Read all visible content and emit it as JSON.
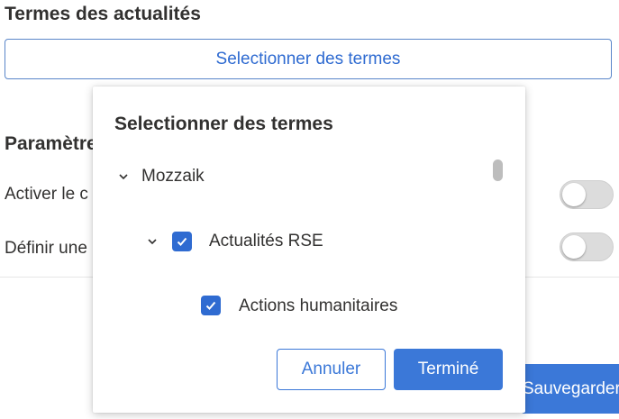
{
  "news_terms": {
    "title": "Termes des actualités",
    "select_button_label": "Selectionner des termes"
  },
  "settings": {
    "title": "Paramètres",
    "rows": [
      {
        "label": "Activer le c",
        "toggle_on": false
      },
      {
        "label": "Définir une",
        "toggle_on": false
      }
    ],
    "save_label": "Sauvegarder"
  },
  "dialog": {
    "title": "Selectionner des termes",
    "tree": [
      {
        "label": "Mozzaik",
        "expanded": true,
        "checked": false,
        "level": 0
      },
      {
        "label": "Actualités RSE",
        "expanded": true,
        "checked": true,
        "level": 1
      },
      {
        "label": "Actions humanitaires",
        "expanded": false,
        "checked": true,
        "level": 2
      }
    ],
    "cancel_label": "Annuler",
    "done_label": "Terminé"
  },
  "colors": {
    "accent": "#3b78d8",
    "link_blue": "#2f6bd1",
    "toggle_off": "#dcdcdc"
  }
}
